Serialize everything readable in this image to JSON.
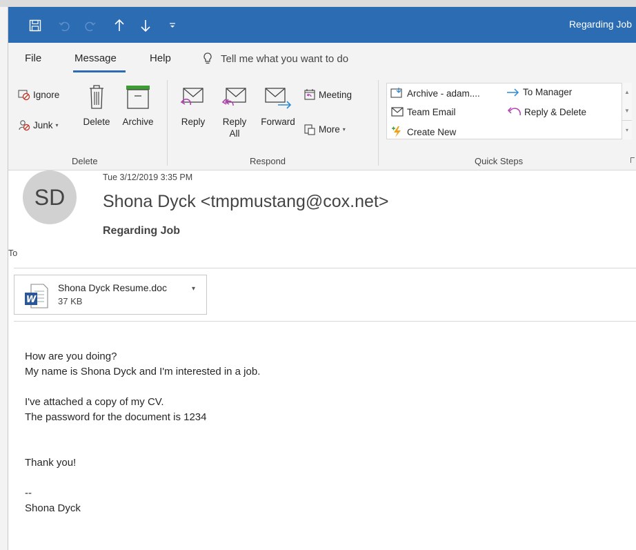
{
  "window": {
    "title": "Regarding Job"
  },
  "menu": {
    "items": [
      "File",
      "Message",
      "Help"
    ],
    "active": "Message",
    "tell_me": "Tell me what you want to do"
  },
  "ribbon": {
    "delete_group": {
      "label": "Delete",
      "ignore": "Ignore",
      "junk": "Junk",
      "delete": "Delete",
      "archive": "Archive"
    },
    "respond_group": {
      "label": "Respond",
      "reply": "Reply",
      "reply_all_line1": "Reply",
      "reply_all_line2": "All",
      "forward": "Forward",
      "meeting": "Meeting",
      "more": "More"
    },
    "quick_steps": {
      "label": "Quick Steps",
      "items": [
        "Archive - adam....",
        "To Manager",
        "Team Email",
        "Reply & Delete",
        "Create New"
      ]
    }
  },
  "message": {
    "avatar_initials": "SD",
    "date": "Tue 3/12/2019 3:35 PM",
    "sender": "Shona Dyck <tmpmustang@cox.net>",
    "subject": "Regarding Job",
    "to_label": "To",
    "attachment": {
      "name": "Shona Dyck Resume.doc",
      "size": "37 KB"
    },
    "body_lines": [
      "How are you doing?",
      "My name is Shona Dyck and I'm interested in a job.",
      "",
      "I've attached a copy of my CV.",
      "The password for the document is 1234",
      "",
      "",
      "Thank you!",
      "",
      "--",
      "Shona Dyck"
    ]
  },
  "colors": {
    "titlebar": "#2b6cb3",
    "ribbon_bg": "#f3f3f3",
    "avatar_bg": "#d1d1d1"
  }
}
